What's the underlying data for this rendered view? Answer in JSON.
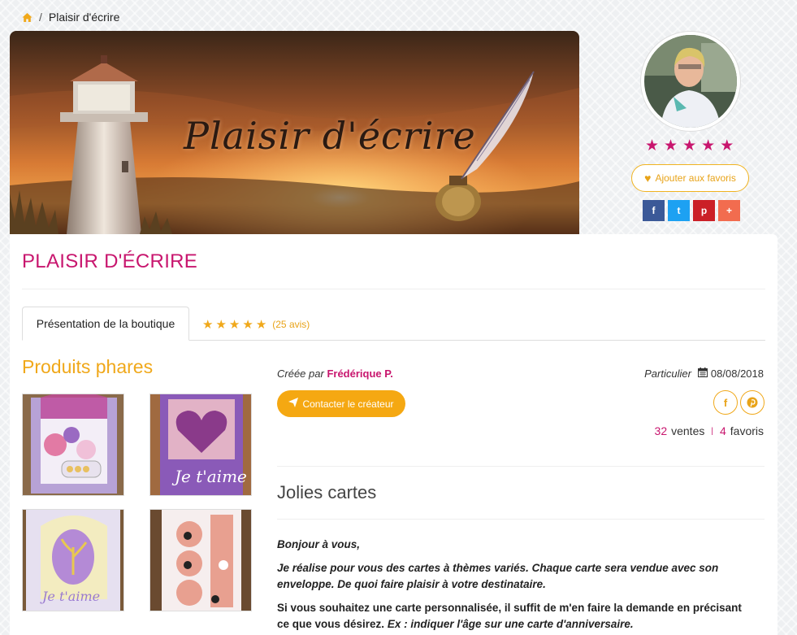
{
  "breadcrumb": {
    "home_icon": "home-icon",
    "separator": "/",
    "current": "Plaisir d'écrire"
  },
  "banner": {
    "title": "Plaisir d'écrire"
  },
  "profile": {
    "rating_stars": 5,
    "favorite_button": "Ajouter aux favoris",
    "social": {
      "facebook": "f",
      "twitter": "t",
      "pinterest": "p",
      "plus": "+"
    }
  },
  "shop": {
    "title": "PLAISIR D'ÉCRIRE",
    "tabs": {
      "presentation": "Présentation de la boutique",
      "reviews_count": "(25 avis)",
      "reviews_stars": 5
    },
    "products_title": "Produits phares",
    "created_by_label": "Créée par",
    "creator": "Frédérique P.",
    "seller_type": "Particulier",
    "created_date": "08/08/2018",
    "contact_button": "Contacter le créateur",
    "stats": {
      "sales_count": "32",
      "sales_label": "ventes",
      "favorites_count": "4",
      "favorites_label": "favoris"
    },
    "section_title": "Jolies cartes",
    "description": {
      "p1": "Bonjour à vous,",
      "p2": "Je réalise pour vous des cartes à thèmes variés. Chaque carte sera vendue avec son enveloppe. De quoi faire plaisir à votre destinataire.",
      "p3_normal": "Si vous souhaitez une carte personnalisée, il suffit de m'en faire la demande en précisant ce que vous désirez.",
      "p3_italic": "Ex : indiquer l'âge sur une carte d'anniversaire."
    }
  },
  "colors": {
    "accent_pink": "#c8166e",
    "accent_orange": "#f5a812"
  }
}
